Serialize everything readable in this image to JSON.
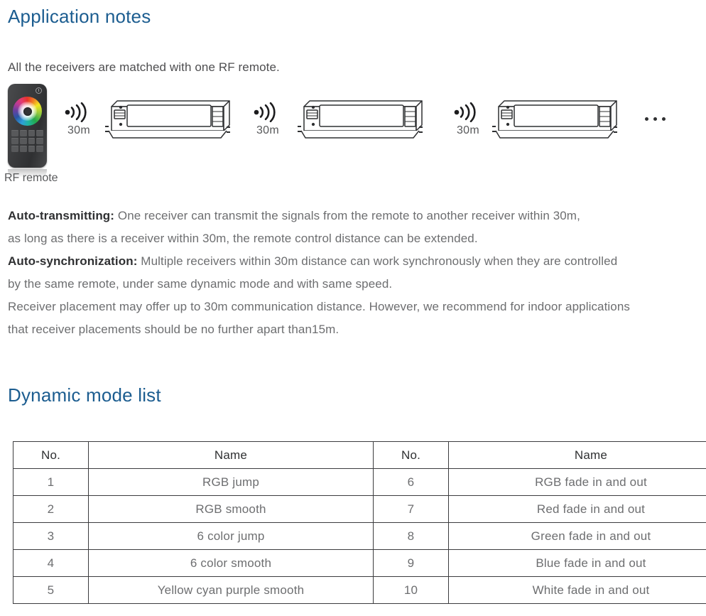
{
  "headings": {
    "application_notes": "Application notes",
    "dynamic_mode_list": "Dynamic mode list"
  },
  "intro": {
    "text": "All the receivers are matched with one RF remote."
  },
  "diagram": {
    "remote_caption": "RF remote",
    "ellipsis": "...",
    "signals": [
      {
        "label": "30m"
      },
      {
        "label": "30m"
      },
      {
        "label": "30m"
      }
    ],
    "icons": {
      "signal": "rf-signal-icon",
      "power": "power-icon",
      "color_wheel": "color-wheel-icon",
      "receiver": "led-receiver-device"
    }
  },
  "notes": {
    "lines": [
      {
        "label": "Auto-transmitting:",
        "text": " One receiver can transmit the signals from the remote to another receiver within 30m,"
      },
      {
        "label": "",
        "text": "as long as there is a receiver within 30m, the remote control distance can be extended."
      },
      {
        "label": "Auto-synchronization:",
        "text": " Multiple receivers within 30m distance can work synchronously when they are controlled"
      },
      {
        "label": "",
        "text": "by the same remote, under same dynamic mode and with same speed."
      },
      {
        "label": "",
        "text": "Receiver placement may offer up to 30m communication distance. However, we recommend for indoor applications"
      },
      {
        "label": "",
        "text": "that receiver placements should be no further apart than15m."
      }
    ]
  },
  "table": {
    "headers": [
      "No.",
      "Name",
      "No.",
      "Name"
    ],
    "rows": [
      [
        "1",
        "RGB jump",
        "6",
        "RGB fade in and out"
      ],
      [
        "2",
        "RGB smooth",
        "7",
        "Red fade in and out"
      ],
      [
        "3",
        "6 color jump",
        "8",
        "Green fade in and out"
      ],
      [
        "4",
        "6 color smooth",
        "9",
        "Blue fade in and out"
      ],
      [
        "5",
        "Yellow cyan purple smooth",
        "10",
        "White fade in and out"
      ]
    ]
  },
  "colors": {
    "heading_blue": "#1c5d90",
    "body_grey": "#6d6e70",
    "bold_dark": "#2f3032",
    "table_border": "#3c3c3e"
  }
}
